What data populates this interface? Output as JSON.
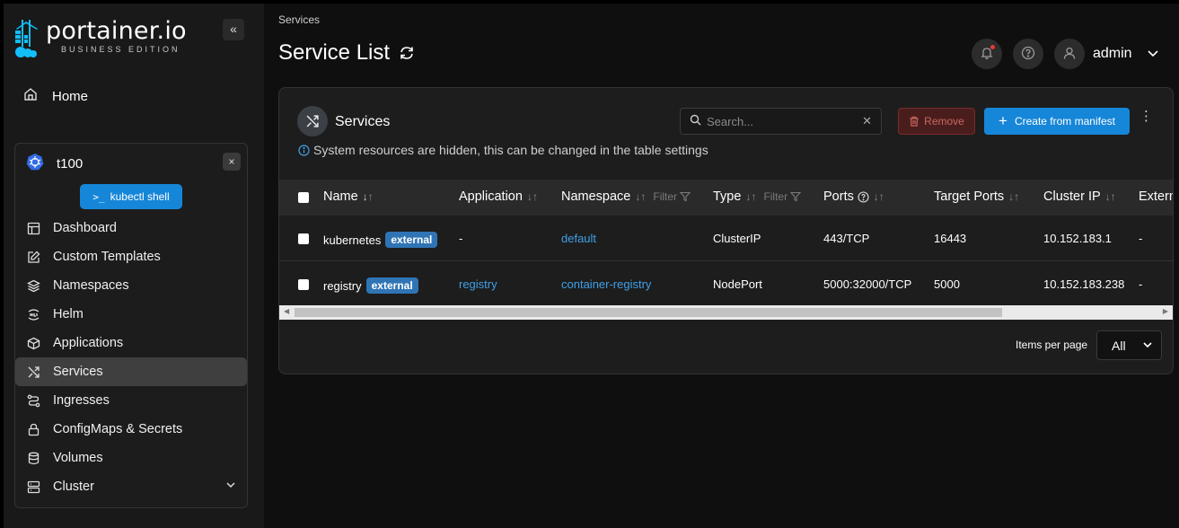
{
  "sidebar": {
    "logo_main": "portainer.io",
    "logo_sub": "BUSINESS EDITION",
    "collapse_label": "«",
    "home_label": "Home",
    "env": {
      "name": "t100",
      "close_label": "×",
      "kubectl_label": "kubectl shell",
      "kubectl_icon_text": ">_"
    },
    "items": [
      {
        "label": "Dashboard",
        "icon": "layout-icon"
      },
      {
        "label": "Custom Templates",
        "icon": "edit-icon"
      },
      {
        "label": "Namespaces",
        "icon": "layers-icon"
      },
      {
        "label": "Helm",
        "icon": "helm-icon"
      },
      {
        "label": "Applications",
        "icon": "box-icon"
      },
      {
        "label": "Services",
        "icon": "shuffle-icon",
        "active": true
      },
      {
        "label": "Ingresses",
        "icon": "route-icon"
      },
      {
        "label": "ConfigMaps & Secrets",
        "icon": "lock-icon"
      },
      {
        "label": "Volumes",
        "icon": "database-icon"
      },
      {
        "label": "Cluster",
        "icon": "server-icon"
      }
    ]
  },
  "header": {
    "breadcrumb": "Services",
    "title": "Service List",
    "user": "admin"
  },
  "panel": {
    "title": "Services",
    "info": "System resources are hidden, this can be changed in the table settings",
    "search_placeholder": "Search...",
    "clear_label": "✕",
    "remove_label": "Remove",
    "create_label": "Create from manifest",
    "kebab": "⋮",
    "columns": {
      "name": "Name",
      "application": "Application",
      "namespace": "Namespace",
      "type": "Type",
      "ports": "Ports",
      "target_ports": "Target Ports",
      "cluster_ip": "Cluster IP",
      "external": "Extern",
      "filter": "Filter"
    },
    "rows": [
      {
        "name": "kubernetes",
        "badge": "external",
        "application": "-",
        "namespace": "default",
        "type": "ClusterIP",
        "ports": "443/TCP",
        "target_ports": "16443",
        "cluster_ip": "10.152.183.1",
        "external": "-"
      },
      {
        "name": "registry",
        "badge": "external",
        "application": "registry",
        "namespace": "container-registry",
        "type": "NodePort",
        "ports": "5000:32000/TCP",
        "target_ports": "5000",
        "cluster_ip": "10.152.183.238",
        "external": "-"
      }
    ],
    "items_per_page_label": "Items per page",
    "items_per_page_value": "All"
  },
  "colors": {
    "accent": "#1686d8",
    "badge": "#2f75b5",
    "link": "#3fa0e8",
    "danger": "#c9675f"
  }
}
